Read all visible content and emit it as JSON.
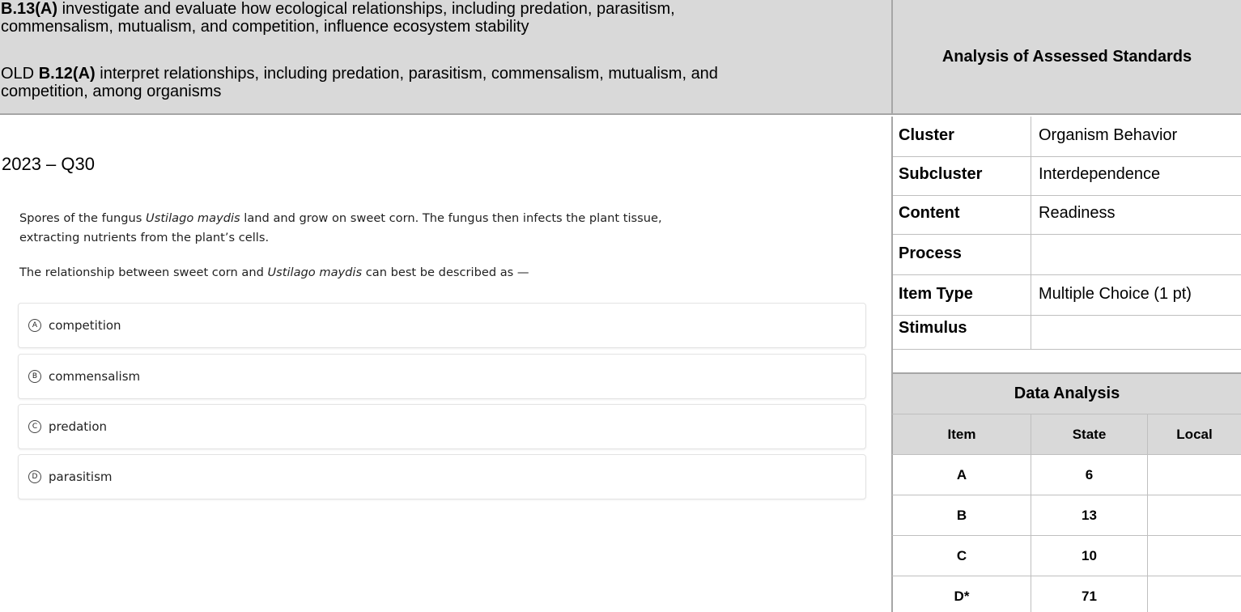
{
  "header": {
    "standard_code": "B.13(A)",
    "standard_text_line1": " investigate and evaluate how ecological relationships, including predation, parasitism,",
    "standard_text_line2": "commensalism, mutualism, and competition, influence ecosystem stability",
    "old_prefix": "OLD ",
    "old_code": "B.12(A)",
    "old_text_line1": " interpret relationships, including predation, parasitism, commensalism, mutualism, and",
    "old_text_line2": "competition, among organisms",
    "analysis_title": "Analysis of Assessed Standards"
  },
  "question": {
    "title": "2023 – Q30",
    "stem1_a": "Spores of the fungus ",
    "stem1_italic": "Ustilago maydis",
    "stem1_b": " land and grow on sweet corn. The fungus then infects the plant tissue,",
    "stem2": "extracting nutrients from the plant’s cells.",
    "stem3_a": "The relationship between sweet corn and ",
    "stem3_italic": "Ustilago maydis",
    "stem3_b": " can best be described as —",
    "options": [
      {
        "letter": "A",
        "text": "competition"
      },
      {
        "letter": "B",
        "text": "commensalism"
      },
      {
        "letter": "C",
        "text": "predation"
      },
      {
        "letter": "D",
        "text": "parasitism"
      }
    ]
  },
  "analysis": {
    "rows": [
      {
        "label": "Cluster",
        "value": "Organism Behavior"
      },
      {
        "label": "Subcluster",
        "value": "Interdependence"
      },
      {
        "label": "Content",
        "value": "Readiness"
      },
      {
        "label": "Process",
        "value": ""
      },
      {
        "label": "Item Type",
        "value": "Multiple Choice (1 pt)"
      },
      {
        "label": "Stimulus",
        "value": ""
      }
    ]
  },
  "data_analysis": {
    "title": "Data Analysis",
    "headers": [
      "Item",
      "State",
      "Local"
    ],
    "rows": [
      {
        "item": "A",
        "state": "6",
        "local": ""
      },
      {
        "item": "B",
        "state": "13",
        "local": ""
      },
      {
        "item": "C",
        "state": "10",
        "local": ""
      },
      {
        "item": "D*",
        "state": "71",
        "local": ""
      }
    ]
  }
}
